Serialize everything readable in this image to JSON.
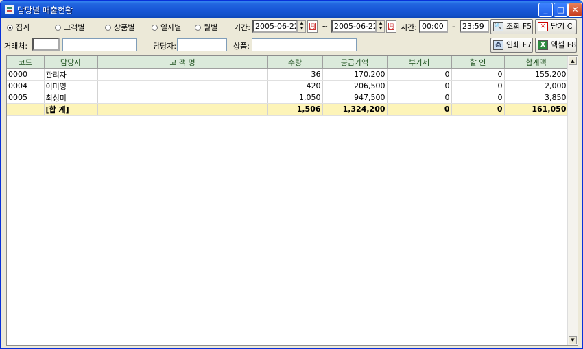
{
  "window": {
    "title": "담당별 매출현황"
  },
  "options": [
    {
      "label": "집계",
      "selected": true
    },
    {
      "label": "고객별",
      "selected": false
    },
    {
      "label": "상품별",
      "selected": false
    },
    {
      "label": "일자별",
      "selected": false
    },
    {
      "label": "월별",
      "selected": false
    }
  ],
  "period": {
    "label": "기간:",
    "from": "2005-06-22",
    "separator": "~",
    "to": "2005-06-22",
    "time_label": "시간:",
    "time_from": "00:00",
    "time_dash": "–",
    "time_to": "23:59"
  },
  "buttons": {
    "query": "조회 F5",
    "close": "닫기 C",
    "print": "인쇄 F7",
    "excel": "엑셀 F8"
  },
  "filters": {
    "customer_label": "거래처:",
    "customer_code": "",
    "customer_name": "",
    "staff_label": "담당자:",
    "staff_value": "",
    "product_label": "상품:",
    "product_value": ""
  },
  "table": {
    "headers": [
      "코드",
      "담당자",
      "고 객 명",
      "수량",
      "공급가액",
      "부가세",
      "할 인",
      "합계액"
    ],
    "rows": [
      [
        "0000",
        "관리자",
        "",
        "36",
        "170,200",
        "0",
        "0",
        "155,200"
      ],
      [
        "0004",
        "이미영",
        "",
        "420",
        "206,500",
        "0",
        "0",
        "2,000"
      ],
      [
        "0005",
        "최성미",
        "",
        "1,050",
        "947,500",
        "0",
        "0",
        "3,850"
      ]
    ],
    "total": [
      "",
      "[합 계]",
      "",
      "1,506",
      "1,324,200",
      "0",
      "0",
      "161,050"
    ]
  },
  "icons": [
    "app-icon",
    "minimize-icon",
    "maximize-icon",
    "close-icon",
    "spin-icon",
    "calendar-icon",
    "search-icon",
    "close-x-icon",
    "print-icon",
    "excel-icon",
    "scroll-up-icon",
    "scroll-down-icon"
  ],
  "colors": {
    "titlebar": "#1857d8",
    "header": "#dbeadb",
    "total_row": "#fdf4b8"
  }
}
